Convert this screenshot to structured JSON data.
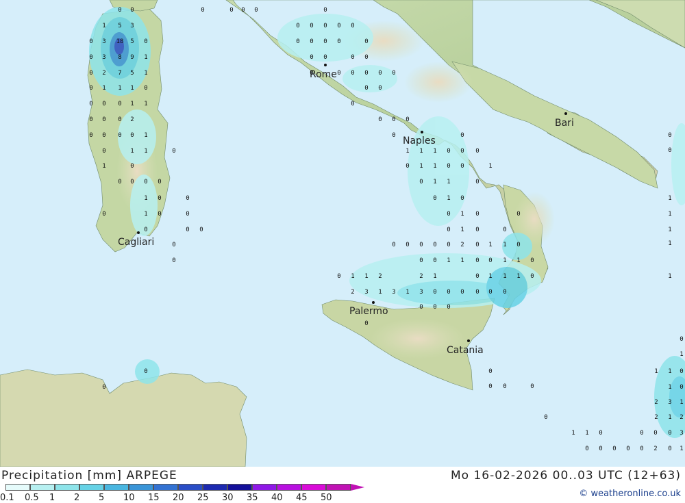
{
  "map": {
    "cities": [
      {
        "name": "Rome"
      },
      {
        "name": "Bari"
      },
      {
        "name": "Naples"
      },
      {
        "name": "Cagliari"
      },
      {
        "name": "Palermo"
      },
      {
        "name": "Catania"
      }
    ],
    "precip_values": [
      {
        "v": "0"
      },
      {
        "v": "0"
      },
      {
        "v": "0"
      },
      {
        "v": "0"
      },
      {
        "v": "0"
      },
      {
        "v": "0"
      },
      {
        "v": "0"
      },
      {
        "v": "1"
      },
      {
        "v": "5"
      },
      {
        "v": "3"
      },
      {
        "v": "0"
      },
      {
        "v": "3"
      },
      {
        "v": "18"
      },
      {
        "v": "5"
      },
      {
        "v": "0"
      },
      {
        "v": "0"
      },
      {
        "v": "3"
      },
      {
        "v": "8"
      },
      {
        "v": "9"
      },
      {
        "v": "1"
      },
      {
        "v": "0"
      },
      {
        "v": "2"
      },
      {
        "v": "7"
      },
      {
        "v": "5"
      },
      {
        "v": "1"
      },
      {
        "v": "0"
      },
      {
        "v": "1"
      },
      {
        "v": "1"
      },
      {
        "v": "1"
      },
      {
        "v": "0"
      },
      {
        "v": "0"
      },
      {
        "v": "0"
      },
      {
        "v": "0"
      },
      {
        "v": "1"
      },
      {
        "v": "1"
      },
      {
        "v": "0"
      },
      {
        "v": "0"
      },
      {
        "v": "0"
      },
      {
        "v": "2"
      },
      {
        "v": "0"
      },
      {
        "v": "0"
      },
      {
        "v": "0"
      },
      {
        "v": "0"
      },
      {
        "v": "1"
      },
      {
        "v": "0"
      },
      {
        "v": "1"
      },
      {
        "v": "1"
      },
      {
        "v": "0"
      },
      {
        "v": "1"
      },
      {
        "v": "0"
      },
      {
        "v": "0"
      },
      {
        "v": "0"
      },
      {
        "v": "0"
      },
      {
        "v": "0"
      },
      {
        "v": "1"
      },
      {
        "v": "0"
      },
      {
        "v": "0"
      },
      {
        "v": "0"
      },
      {
        "v": "1"
      },
      {
        "v": "0"
      },
      {
        "v": "0"
      },
      {
        "v": "0"
      },
      {
        "v": "0"
      },
      {
        "v": "0"
      },
      {
        "v": "0"
      },
      {
        "v": "0"
      },
      {
        "v": "0"
      },
      {
        "v": "0"
      },
      {
        "v": "0"
      },
      {
        "v": "0"
      },
      {
        "v": "0"
      },
      {
        "v": "0"
      },
      {
        "v": "0"
      },
      {
        "v": "0"
      },
      {
        "v": "0"
      },
      {
        "v": "0"
      },
      {
        "v": "0"
      },
      {
        "v": "0"
      },
      {
        "v": "0"
      },
      {
        "v": "0"
      },
      {
        "v": "0"
      },
      {
        "v": "0"
      },
      {
        "v": "0"
      },
      {
        "v": "0"
      },
      {
        "v": "0"
      },
      {
        "v": "0"
      },
      {
        "v": "0"
      },
      {
        "v": "0"
      },
      {
        "v": "0"
      },
      {
        "v": "0"
      },
      {
        "v": "0"
      },
      {
        "v": "0"
      },
      {
        "v": "0"
      },
      {
        "v": "1"
      },
      {
        "v": "1"
      },
      {
        "v": "1"
      },
      {
        "v": "0"
      },
      {
        "v": "0"
      },
      {
        "v": "0"
      },
      {
        "v": "0"
      },
      {
        "v": "1"
      },
      {
        "v": "1"
      },
      {
        "v": "0"
      },
      {
        "v": "0"
      },
      {
        "v": "0"
      },
      {
        "v": "1"
      },
      {
        "v": "1"
      },
      {
        "v": "0"
      },
      {
        "v": "0"
      },
      {
        "v": "1"
      },
      {
        "v": "0"
      },
      {
        "v": "0"
      },
      {
        "v": "1"
      },
      {
        "v": "0"
      },
      {
        "v": "0"
      },
      {
        "v": "1"
      },
      {
        "v": "0"
      },
      {
        "v": "0"
      },
      {
        "v": "0"
      },
      {
        "v": "1"
      },
      {
        "v": "0"
      },
      {
        "v": "0"
      },
      {
        "v": "0"
      },
      {
        "v": "0"
      },
      {
        "v": "0"
      },
      {
        "v": "0"
      },
      {
        "v": "2"
      },
      {
        "v": "0"
      },
      {
        "v": "1"
      },
      {
        "v": "1"
      },
      {
        "v": "0"
      },
      {
        "v": "0"
      },
      {
        "v": "0"
      },
      {
        "v": "1"
      },
      {
        "v": "1"
      },
      {
        "v": "0"
      },
      {
        "v": "0"
      },
      {
        "v": "1"
      },
      {
        "v": "1"
      },
      {
        "v": "0"
      },
      {
        "v": "0"
      },
      {
        "v": "1"
      },
      {
        "v": "1"
      },
      {
        "v": "2"
      },
      {
        "v": "2"
      },
      {
        "v": "1"
      },
      {
        "v": "0"
      },
      {
        "v": "1"
      },
      {
        "v": "1"
      },
      {
        "v": "1"
      },
      {
        "v": "0"
      },
      {
        "v": "1"
      },
      {
        "v": "2"
      },
      {
        "v": "3"
      },
      {
        "v": "1"
      },
      {
        "v": "3"
      },
      {
        "v": "1"
      },
      {
        "v": "3"
      },
      {
        "v": "0"
      },
      {
        "v": "0"
      },
      {
        "v": "0"
      },
      {
        "v": "0"
      },
      {
        "v": "0"
      },
      {
        "v": "0"
      },
      {
        "v": "0"
      },
      {
        "v": "0"
      },
      {
        "v": "0"
      },
      {
        "v": "0"
      },
      {
        "v": "0"
      },
      {
        "v": "0"
      },
      {
        "v": "0"
      },
      {
        "v": "0"
      },
      {
        "v": "0"
      },
      {
        "v": "1"
      },
      {
        "v": "1"
      },
      {
        "v": "0"
      },
      {
        "v": "0"
      },
      {
        "v": "0"
      },
      {
        "v": "0"
      },
      {
        "v": "0"
      },
      {
        "v": "0"
      },
      {
        "v": "0"
      },
      {
        "v": "0"
      },
      {
        "v": "0"
      },
      {
        "v": "2"
      },
      {
        "v": "0"
      },
      {
        "v": "0"
      },
      {
        "v": "0"
      },
      {
        "v": "1"
      },
      {
        "v": "1"
      },
      {
        "v": "0"
      },
      {
        "v": "0"
      },
      {
        "v": "1"
      },
      {
        "v": "1"
      },
      {
        "v": "1"
      },
      {
        "v": "0"
      },
      {
        "v": "1"
      },
      {
        "v": "1"
      },
      {
        "v": "2"
      },
      {
        "v": "3"
      },
      {
        "v": "1"
      },
      {
        "v": "2"
      },
      {
        "v": "3"
      },
      {
        "v": "1"
      },
      {
        "v": "1"
      },
      {
        "v": "2"
      },
      {
        "v": "0"
      },
      {
        "v": "1"
      },
      {
        "v": "0"
      }
    ]
  },
  "footer": {
    "title": "Precipitation [mm] ARPEGE",
    "datetime": "Mo 16-02-2026 00..03 UTC (12+63)",
    "credit": "© weatheronline.co.uk",
    "legend": [
      {
        "label": "0.1",
        "color": "#e6fbfb"
      },
      {
        "label": "0.5",
        "color": "#b7f0f1"
      },
      {
        "label": "1",
        "color": "#8ee4ea"
      },
      {
        "label": "2",
        "color": "#66d2e6"
      },
      {
        "label": "5",
        "color": "#4ab6e0"
      },
      {
        "label": "10",
        "color": "#3a95d8"
      },
      {
        "label": "15",
        "color": "#3372d2"
      },
      {
        "label": "20",
        "color": "#2a4ec6"
      },
      {
        "label": "25",
        "color": "#1d2ab0"
      },
      {
        "label": "30",
        "color": "#14109a"
      },
      {
        "label": "35",
        "color": "#8f18e6"
      },
      {
        "label": "40",
        "color": "#b810e0"
      },
      {
        "label": "45",
        "color": "#d90cd8"
      },
      {
        "label": "50",
        "color": "#c012b4"
      }
    ]
  }
}
